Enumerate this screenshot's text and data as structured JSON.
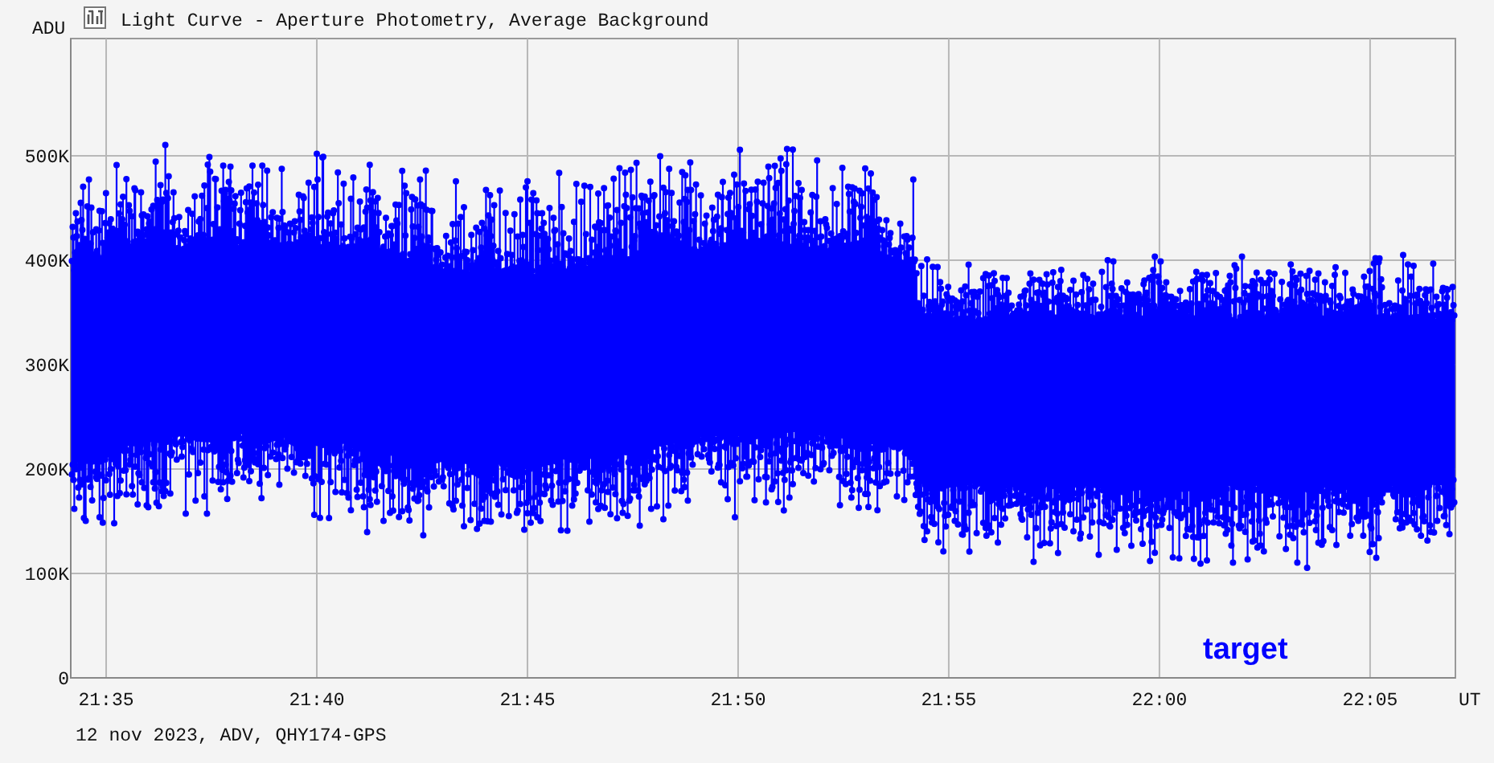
{
  "window": {
    "title": "Light Curve - Aperture Photometry, Average Background"
  },
  "chart": {
    "unit_label": "ADU",
    "x_axis_label": "UT",
    "y_tick_labels": [
      "500K",
      "400K",
      "300K",
      "200K",
      "100K",
      "0"
    ],
    "x_tick_labels": [
      "21:35",
      "21:40",
      "21:45",
      "21:50",
      "21:55",
      "22:00",
      "22:05"
    ],
    "legend": {
      "label": "target",
      "color": "#0000ff"
    }
  },
  "footer": "12 nov 2023, ADV, QHY174-GPS"
}
